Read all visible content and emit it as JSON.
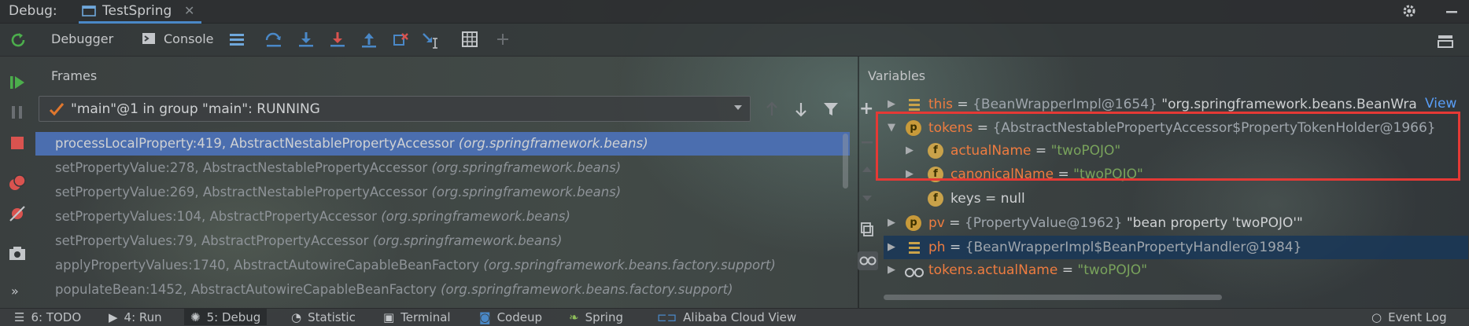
{
  "title_bar": {
    "debug_label": "Debug:",
    "session_tab": "TestSpring"
  },
  "toolbar": {
    "tabs": [
      "Debugger",
      "Console"
    ]
  },
  "frames_pane": {
    "header": "Frames",
    "thread": "\"main\"@1 in group \"main\": RUNNING",
    "frames": [
      {
        "method": "processLocalProperty:419, AbstractNestablePropertyAccessor",
        "package": "(org.springframework.beans)",
        "selected": true
      },
      {
        "method": "setPropertyValue:278, AbstractNestablePropertyAccessor",
        "package": "(org.springframework.beans)",
        "selected": false
      },
      {
        "method": "setPropertyValue:269, AbstractNestablePropertyAccessor",
        "package": "(org.springframework.beans)",
        "selected": false
      },
      {
        "method": "setPropertyValues:104, AbstractPropertyAccessor",
        "package": "(org.springframework.beans)",
        "selected": false
      },
      {
        "method": "setPropertyValues:79, AbstractPropertyAccessor",
        "package": "(org.springframework.beans)",
        "selected": false
      },
      {
        "method": "applyPropertyValues:1740, AbstractAutowireCapableBeanFactory",
        "package": "(org.springframework.beans.factory.support)",
        "selected": false
      },
      {
        "method": "populateBean:1452, AbstractAutowireCapableBeanFactory",
        "package": "(org.springframework.beans.factory.support)",
        "selected": false
      }
    ]
  },
  "variables_pane": {
    "header": "Variables",
    "view_link": "View",
    "vars": [
      {
        "name": "this",
        "eq": " = ",
        "type": "{BeanWrapperImpl@1654}",
        "value": " \"org.springframework.beans.BeanWra"
      },
      {
        "name": "tokens",
        "eq": " = ",
        "type": "{AbstractNestablePropertyAccessor$PropertyTokenHolder@1966}",
        "value": ""
      },
      {
        "name": "actualName",
        "eq": " = ",
        "type": "",
        "value": "\"twoPOJO\""
      },
      {
        "name": "canonicalName",
        "eq": " = ",
        "type": "",
        "value": "\"twoPOJO\""
      },
      {
        "name": "keys",
        "eq": " = ",
        "type": "",
        "value": "null"
      },
      {
        "name": "pv",
        "eq": " = ",
        "type": "{PropertyValue@1962}",
        "value": " \"bean property 'twoPOJO'\""
      },
      {
        "name": "ph",
        "eq": " = ",
        "type": "{BeanWrapperImpl$BeanPropertyHandler@1984}",
        "value": ""
      },
      {
        "name": "tokens.actualName",
        "eq": " = ",
        "type": "",
        "value": "\"twoPOJO\""
      }
    ],
    "badges": {
      "p": "p",
      "f": "f"
    }
  },
  "bottom_bar": {
    "items": [
      "6: TODO",
      "4: Run",
      "5: Debug",
      "Statistic",
      "Terminal",
      "Codeup",
      "Spring",
      "Alibaba Cloud View",
      "Event Log"
    ]
  },
  "colors": {
    "accent": "#4a88c7",
    "selection": "#4b6eaf",
    "highlight_border": "#e53935",
    "var_name": "#ee7c40",
    "string_value": "#79a35c"
  }
}
